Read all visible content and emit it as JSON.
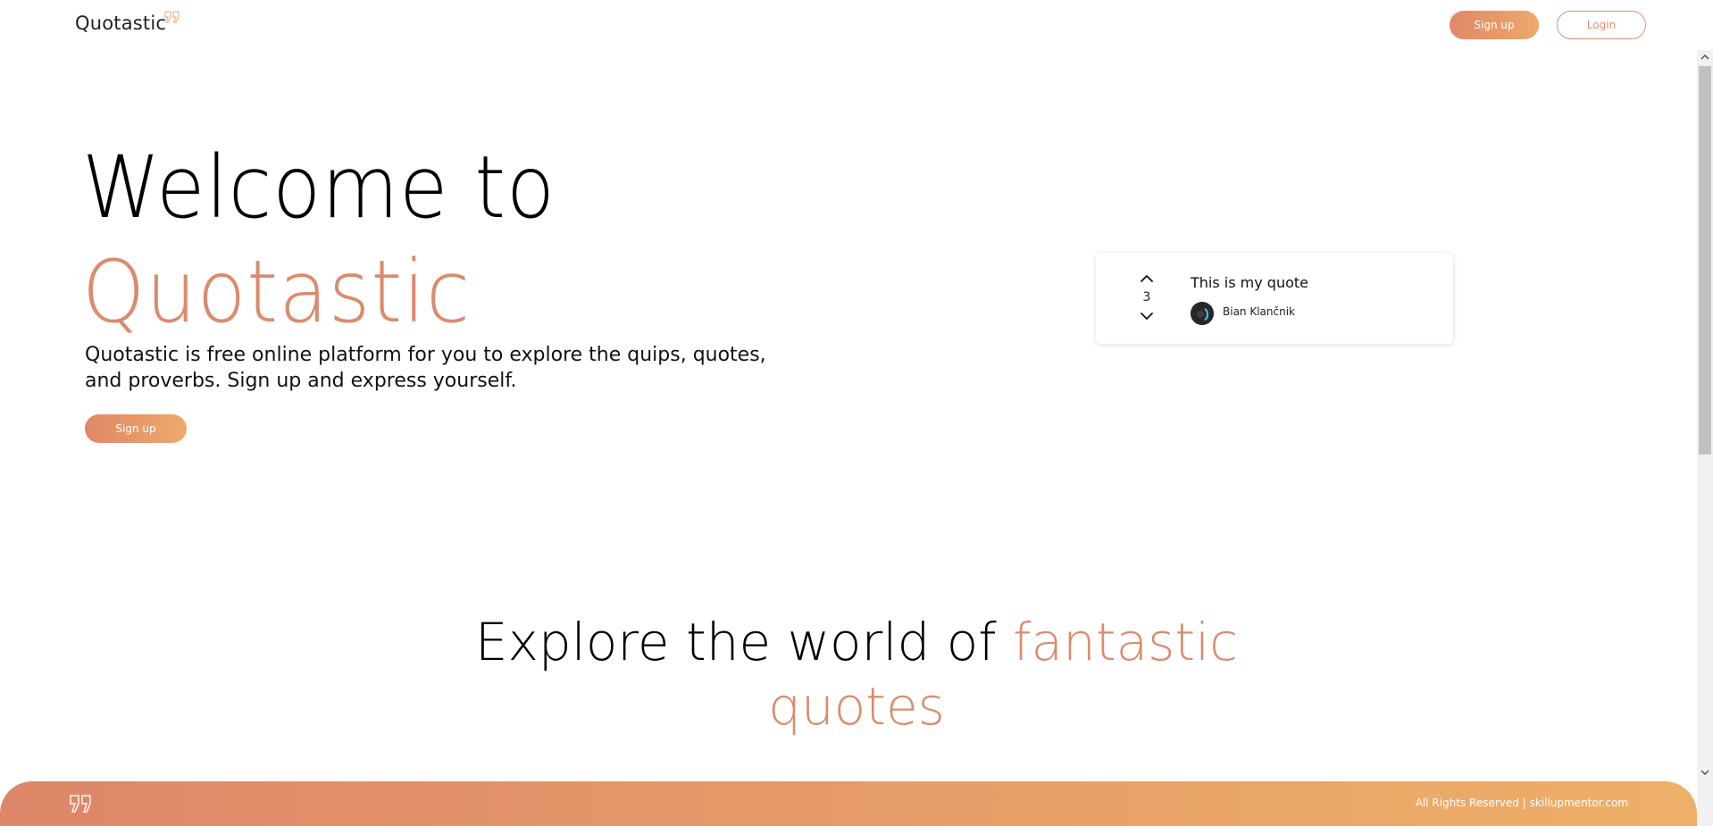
{
  "header": {
    "logo_text": "Quotastic",
    "logo_icon": "quote-mark-icon",
    "signup_label": "Sign up",
    "login_label": "Login"
  },
  "hero": {
    "title_line1": "Welcome to",
    "title_line2": "Quotastic",
    "description": "Quotastic is free online platform for you to explore the quips, quotes, and proverbs. Sign up and express yourself.",
    "signup_label": "Sign up"
  },
  "quote_card": {
    "votes": "3",
    "text": "This is my quote",
    "author": "Bian Klančnik",
    "upvote_icon": "chevron-up-icon",
    "downvote_icon": "chevron-down-icon"
  },
  "explore": {
    "title_plain": "Explore the world of ",
    "title_accent": "fantastic quotes"
  },
  "footer": {
    "icon": "quote-mark-icon",
    "copyright": "All Rights Reserved | skillupmentor.com"
  },
  "colors": {
    "accent": "#dc8a6d",
    "gradient_start": "#e08768",
    "gradient_end": "#eeb068"
  }
}
